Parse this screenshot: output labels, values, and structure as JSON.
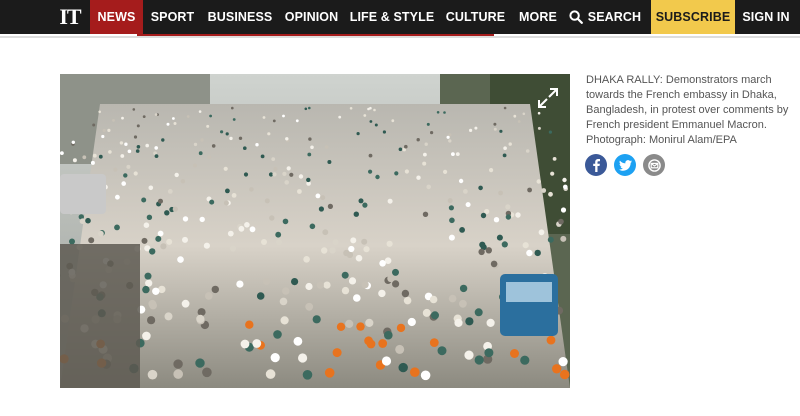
{
  "header": {
    "logo": "IT",
    "nav": [
      {
        "label": "NEWS",
        "active": true
      },
      {
        "label": "SPORT"
      },
      {
        "label": "BUSINESS"
      },
      {
        "label": "OPINION"
      },
      {
        "label": "LIFE & STYLE"
      },
      {
        "label": "CULTURE"
      },
      {
        "label": "MORE"
      }
    ],
    "search_label": "SEARCH",
    "subscribe_label": "SUBSCRIBE",
    "signin_label": "SIGN IN",
    "colors": {
      "bar": "#1b1b1b",
      "active": "#a51c1c",
      "subscribe": "#f2c94c"
    }
  },
  "article": {
    "image": {
      "subject": "crowd-of-demonstrators-photo",
      "expand_icon": "expand-icon"
    },
    "caption": {
      "lead": "DHAKA RALLY:",
      "text": "Demonstrators march towards the French embassy in Dhaka, Bangladesh, in protest over comments by French president Emmanuel Macron. Photograph: Monirul Alam/EPA"
    },
    "share": [
      {
        "icon": "facebook-icon",
        "color": "#3b5998"
      },
      {
        "icon": "twitter-icon",
        "color": "#1da1f2"
      },
      {
        "icon": "email-icon",
        "color": "#8a8a8a"
      }
    ]
  }
}
